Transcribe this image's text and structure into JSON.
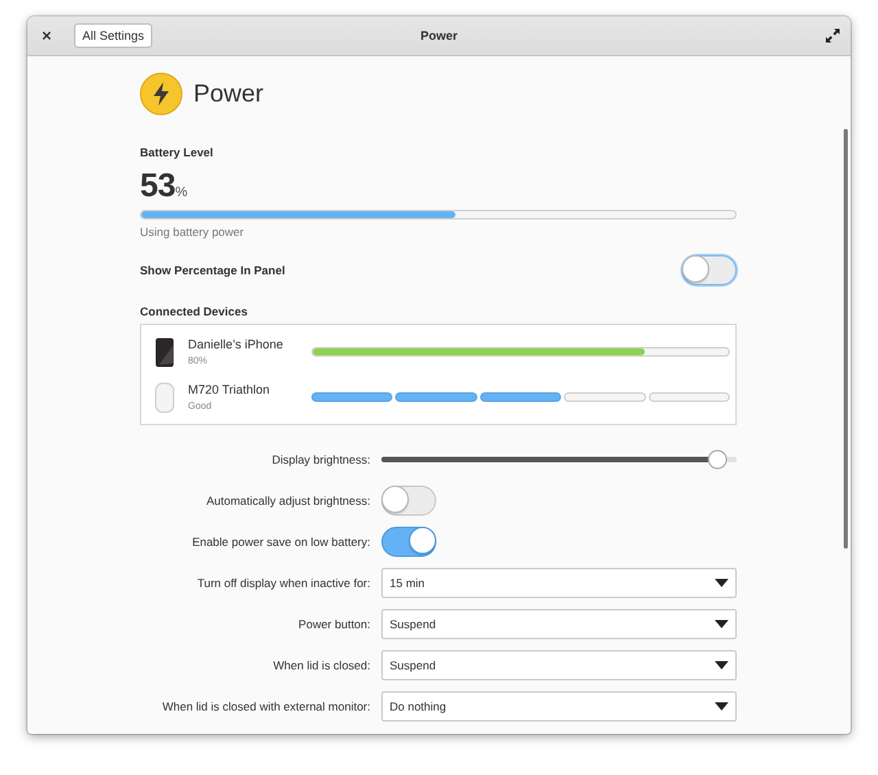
{
  "window": {
    "title": "Power",
    "back_button": "All Settings",
    "close": "×"
  },
  "header": {
    "title": "Power"
  },
  "battery": {
    "heading": "Battery Level",
    "percent": "53",
    "unit": "%",
    "level": 0.53,
    "status": "Using battery power"
  },
  "show_percentage": {
    "label": "Show Percentage In Panel",
    "on": false
  },
  "devices": {
    "heading": "Connected Devices",
    "items": [
      {
        "name": "Danielle’s iPhone",
        "detail": "80%",
        "kind": "phone",
        "level": 0.8
      },
      {
        "name": "M720 Triathlon",
        "detail": "Good",
        "kind": "mouse",
        "level": 0.6
      }
    ]
  },
  "settings": [
    {
      "label": "Display brightness:",
      "kind": "slider",
      "level": 0.95
    },
    {
      "label": "Automatically adjust brightness:",
      "kind": "switch",
      "on": false
    },
    {
      "label": "Enable power save on low battery:",
      "kind": "switch",
      "on": true
    },
    {
      "label": "Turn off display when inactive for:",
      "kind": "dropdown",
      "value": "15 min"
    },
    {
      "label": "Power button:",
      "kind": "dropdown",
      "value": "Suspend"
    },
    {
      "label": "When lid is closed:",
      "kind": "dropdown",
      "value": "Suspend"
    },
    {
      "label": "When lid is closed with external monitor:",
      "kind": "dropdown",
      "value": "Do nothing"
    }
  ]
}
